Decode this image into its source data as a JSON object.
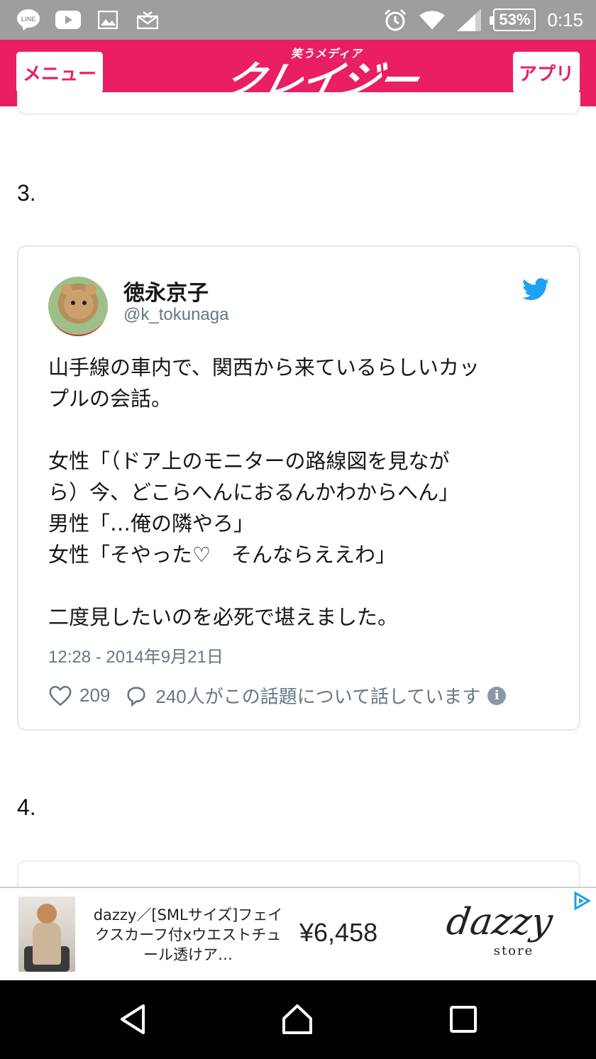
{
  "status_bar": {
    "battery": "53%",
    "time": "0:15",
    "left_icons": [
      "line-icon",
      "youtube-icon",
      "gallery-icon",
      "mail-icon"
    ],
    "right_icons": [
      "alarm-icon",
      "wifi-icon",
      "signal-icon"
    ]
  },
  "header": {
    "menu_label": "メニュー",
    "logo_sub": "笑うメディア",
    "logo_main": "クレイジー",
    "app_label": "アプリ",
    "color": "#e91e63"
  },
  "sections": {
    "item3": "3.",
    "item4": "4."
  },
  "tweet": {
    "name": "徳永京子",
    "handle": "@k_tokunaga",
    "lines": [
      "山手線の車内で、関西から来ているらしいカッ",
      "プルの会話。",
      "",
      "女性「（ドア上のモニターの路線図を見なが",
      "ら）今、どこらへんにおるんかわからへん」",
      "男性「…俺の隣やろ」",
      "女性「そやった♡　そんならええわ」",
      "",
      "二度見したいのを必死で堪えました。"
    ],
    "timestamp": "12:28 - 2014年9月21日",
    "likes": "209",
    "replies": "240人がこの話題について話しています",
    "brand_color": "#1da1f2"
  },
  "ad": {
    "title": "dazzy／[SMLサイズ]フェイクスカーフ付xウエストチュール透けア…",
    "price": "¥6,458",
    "brand": "dazzy",
    "brand_sub": "store"
  },
  "nav": {
    "icons": [
      "back-icon",
      "home-icon",
      "recents-icon"
    ]
  }
}
